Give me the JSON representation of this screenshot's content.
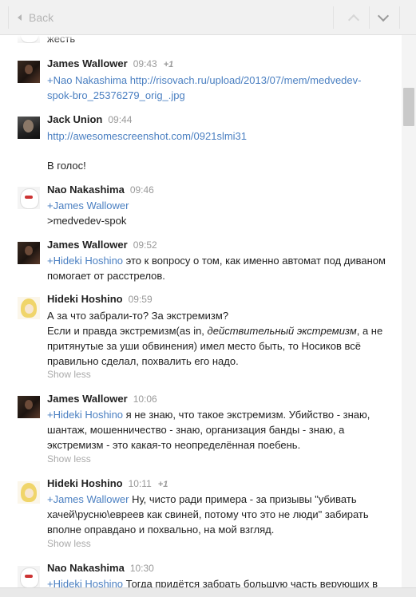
{
  "toolbar": {
    "back_label": "Back"
  },
  "comments": [
    {
      "author": "",
      "time": "",
      "plus": "",
      "lines": [
        "жесть"
      ]
    },
    {
      "author": "James Wallower",
      "time": "09:43",
      "plus": "+1",
      "mention": "+Nao Nakashima",
      "link_text": "http://risovach.ru/upload/2013/07/mem/medvedev-spok-bro_25376279_orig_.jpg",
      "link_line1": "http://risovach.ru/upload/2013/07/mem/medvedev-",
      "link_line2": "spok-bro_25376279_orig_.jpg"
    },
    {
      "author": "Jack Union",
      "time": "09:44",
      "link": "http://awesomescreenshot.com/0921slmi31",
      "text": "В голос!"
    },
    {
      "author": "Nao Nakashima",
      "time": "09:46",
      "mention_plus": "+",
      "mention_name": "James Wallower",
      "text": ">medvedev-spok"
    },
    {
      "author": "James Wallower",
      "time": "09:52",
      "mention_plus": "+",
      "mention_name": "Hideki Hoshino",
      "line1_rest": " это к вопросу о том, как именно автомат под диваном",
      "line2": "помогает от расстрелов."
    },
    {
      "author": "Hideki Hoshino",
      "time": "09:59",
      "line1": "А за что забрали-то? За экстремизм?",
      "line2_a": "Если и правда экстремизм(as in, ",
      "line2_em": "действительный экстремизм",
      "line2_b": ", а не",
      "line3": "притянутые за уши обвинения) имел место быть, то Носиков всё",
      "line4": "правильно сделал, похвалить его надо.",
      "show_less": "Show less"
    },
    {
      "author": "James Wallower",
      "time": "10:06",
      "mention_plus": "+",
      "mention_name": "Hideki Hoshino",
      "line1_rest": " я не знаю, что такое экстремизм. Убийство - знаю,",
      "line2": "шантаж, мошенничество - знаю, организация банды - знаю, а",
      "line3": "экстремизм - это какая-то неопределённая поебень.",
      "show_less": "Show less"
    },
    {
      "author": "Hideki Hoshino",
      "time": "10:11",
      "plus": "+1",
      "mention_plus": "+",
      "mention_name": "James Wallower",
      "line1_rest": " Ну, чисто ради примера - за призывы \"убивать",
      "line2": "хачей\\русню\\евреев как свиней, потому что это не люди\" забирать",
      "line3": "вполне оправдано и похвально, на мой взгляд.",
      "show_less": "Show less"
    },
    {
      "author": "Nao Nakashima",
      "time": "10:30",
      "mention_plus": "+",
      "mention_name": "Hideki Hoshino",
      "line1_rest": " Тогда придётся забрать большую часть верующих в"
    }
  ]
}
